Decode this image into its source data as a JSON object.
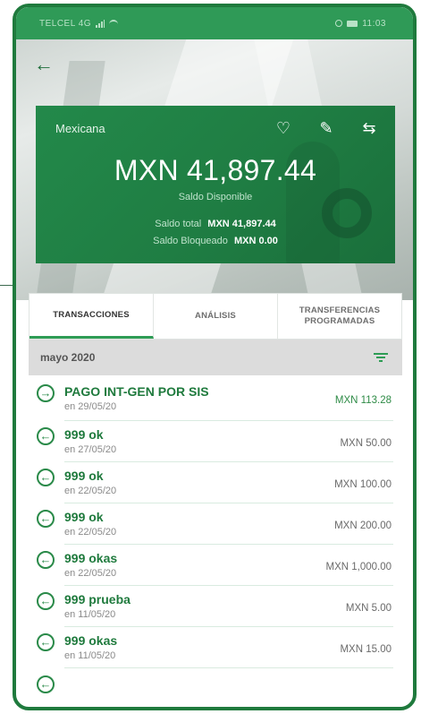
{
  "status_bar": {
    "carrier": "TELCEL 4G",
    "time": "11:03"
  },
  "account": {
    "name": "Mexicana",
    "balance": "MXN 41,897.44",
    "balance_label": "Saldo Disponible",
    "total_label": "Saldo total",
    "total_value": "MXN 41,897.44",
    "blocked_label": "Saldo Bloqueado",
    "blocked_value": "MXN 0.00"
  },
  "tabs": [
    {
      "label": "TRANSACCIONES",
      "active": true
    },
    {
      "label": "ANÁLISIS",
      "active": false
    },
    {
      "label": "TRANSFERENCIAS PROGRAMADAS",
      "active": false
    }
  ],
  "month": "mayo 2020",
  "transactions": [
    {
      "title": "PAGO INT-GEN POR SIS",
      "date": "en 29/05/20",
      "amount": "MXN 113.28",
      "direction": "in"
    },
    {
      "title": "999 ok",
      "date": "en 27/05/20",
      "amount": "MXN 50.00",
      "direction": "out"
    },
    {
      "title": "999 ok",
      "date": "en 22/05/20",
      "amount": "MXN 100.00",
      "direction": "out"
    },
    {
      "title": "999 ok",
      "date": "en 22/05/20",
      "amount": "MXN 200.00",
      "direction": "out"
    },
    {
      "title": "999 okas",
      "date": "en 22/05/20",
      "amount": "MXN 1,000.00",
      "direction": "out"
    },
    {
      "title": "999 prueba",
      "date": "en 11/05/20",
      "amount": "MXN 5.00",
      "direction": "out"
    },
    {
      "title": "999 okas",
      "date": "en 11/05/20",
      "amount": "MXN 15.00",
      "direction": "out"
    }
  ],
  "colors": {
    "primary": "#1f7a3d",
    "card": "#23894a",
    "income": "#2e8b46"
  },
  "icons": {
    "back": "arrow-left-icon",
    "favorite": "heart-icon",
    "edit": "pencil-icon",
    "transfer": "transfer-arrows-icon",
    "filter": "filter-icon",
    "incoming": "arrow-right-circle-icon",
    "outgoing": "arrow-left-circle-icon"
  }
}
